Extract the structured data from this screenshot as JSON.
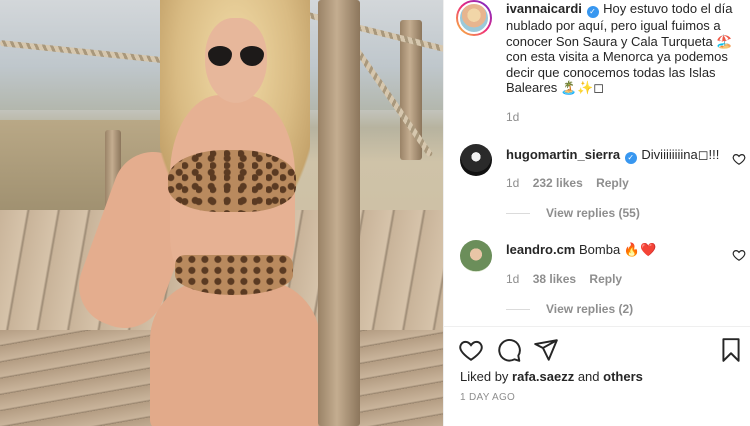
{
  "post": {
    "author": "ivannaicardi",
    "caption": "Hoy estuvo todo el día nublado por aquí, pero igual fuimos a conocer Son Saura y Cala Turqueta 🏖️con esta visita a Menorca ya podemos decir que conocemos todas las Islas Baleares 🏝️✨◻",
    "age": "1d"
  },
  "comments": [
    {
      "username": "hugomartin_sierra",
      "text": "Diviiiiiiiina◻!!!",
      "age": "1d",
      "likes": "232 likes",
      "reply_label": "Reply",
      "view_replies": "View replies (55)"
    },
    {
      "username": "leandro.cm",
      "text": "Bomba 🔥❤️",
      "age": "1d",
      "likes": "38 likes",
      "reply_label": "Reply",
      "view_replies": "View replies (2)"
    }
  ],
  "footer": {
    "liked_by_prefix": "Liked by",
    "liked_by_user": "rafa.saezz",
    "liked_by_and": "and",
    "liked_by_others": "others",
    "timestamp": "1 DAY AGO"
  },
  "icons": [
    "verified-badge-icon",
    "heart-icon",
    "comment-icon",
    "share-icon",
    "bookmark-icon"
  ],
  "colors": {
    "verified": "#3897f0",
    "meta_text": "#8e8e8e",
    "text": "#262626"
  }
}
